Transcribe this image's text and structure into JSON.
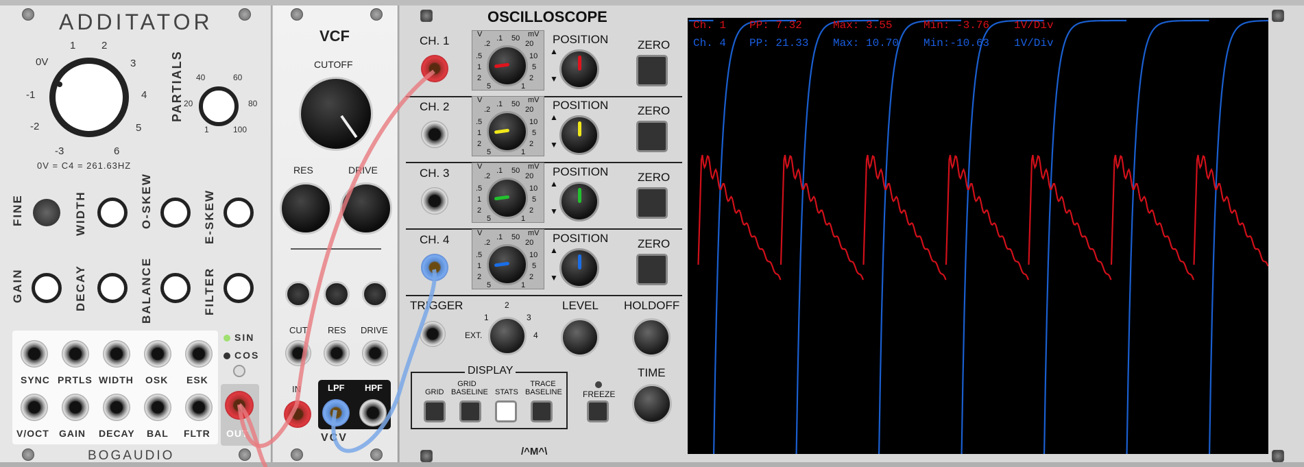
{
  "additator": {
    "title": "ADDITATOR",
    "brand": "BOGAUDIO",
    "freq_labels": [
      "0V",
      "1",
      "2",
      "3",
      "4",
      "5",
      "6",
      "-3",
      "-2",
      "-1"
    ],
    "freq_note": "0V = C4 = 261.63HZ",
    "partials_label": "PARTIALS",
    "partials_ticks": [
      "20",
      "40",
      "60",
      "80",
      "100",
      "1"
    ],
    "knob_labels": {
      "fine": "FINE",
      "width": "WIDTH",
      "oskew": "O-SKEW",
      "eskew": "E-SKEW",
      "gain": "GAIN",
      "decay": "DECAY",
      "balance": "BALANCE",
      "filter": "FILTER"
    },
    "zero": "0",
    "minus": "-",
    "plus": "+",
    "phase_options": [
      "SIN",
      "COS"
    ],
    "jack_labels_top": [
      "SYNC",
      "PRTLS",
      "WIDTH",
      "OSK",
      "ESK"
    ],
    "jack_labels_bottom": [
      "V/OCT",
      "GAIN",
      "DECAY",
      "BAL",
      "FLTR"
    ],
    "out_label": "OUT"
  },
  "vcf": {
    "title": "VCF",
    "cutoff": "CUTOFF",
    "res": "RES",
    "drive": "DRIVE",
    "cv_labels": [
      "CUT",
      "RES",
      "DRIVE"
    ],
    "in": "IN",
    "lpf": "LPF",
    "hpf": "HPF",
    "brand": "VCV"
  },
  "scope": {
    "title": "OSCILLOSCOPE",
    "channels": [
      {
        "label": "CH. 1",
        "color": "#e0141e"
      },
      {
        "label": "CH. 2",
        "color": "#f0e81a"
      },
      {
        "label": "CH. 3",
        "color": "#22c02e"
      },
      {
        "label": "CH. 4",
        "color": "#1a6ee8"
      }
    ],
    "scale_left": [
      "V",
      ".1",
      ".2",
      ".5",
      "1",
      "2",
      "5"
    ],
    "scale_right": [
      "50",
      "mV",
      "20",
      "10",
      "5",
      "2",
      "1"
    ],
    "position": "POSITION",
    "zero": "ZERO",
    "trigger": "TRIGGER",
    "ext": "EXT.",
    "trigger_ticks": [
      "1",
      "2",
      "3",
      "4"
    ],
    "level": "LEVEL",
    "holdoff": "HOLDOFF",
    "display": "DISPLAY",
    "display_buttons": [
      "GRID",
      "GRID BASELINE",
      "STATS",
      "TRACE BASELINE"
    ],
    "freeze": "FREEZE",
    "time": "TIME",
    "logo": "/^M^\\",
    "stats": [
      {
        "ch": "Ch. 1",
        "pp": "PP:  7.32",
        "max": "Max:  3.55",
        "min": "Min: -3.76",
        "div": "1V/Div",
        "color": "#d8101a"
      },
      {
        "ch": "Ch. 4",
        "pp": "PP: 21.33",
        "max": "Max: 10.70",
        "min": "Min:-10.63",
        "div": "1V/Div",
        "color": "#1a5ee0"
      }
    ]
  },
  "colors": {
    "ch1": "#e0141e",
    "ch4": "#1a6ee8",
    "cable_red": "#e87a80",
    "cable_blue": "#7aa8e8"
  }
}
